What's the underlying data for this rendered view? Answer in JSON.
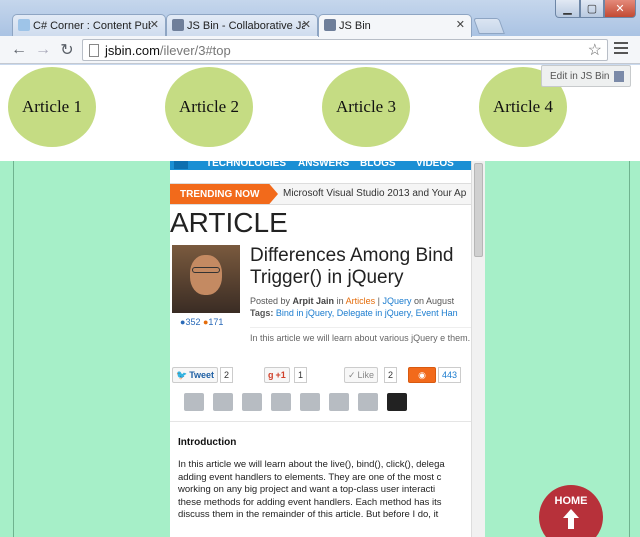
{
  "tabs": [
    {
      "title": "C# Corner : Content Publi",
      "active": false
    },
    {
      "title": "JS Bin - Collaborative Java",
      "active": false
    },
    {
      "title": "JS Bin",
      "active": true
    }
  ],
  "address": {
    "host": "jsbin.com",
    "path": "/ilever/3#top"
  },
  "articles": [
    "Article 1",
    "Article 2",
    "Article 3",
    "Article 4"
  ],
  "edit_button": "Edit in JS Bin",
  "site": {
    "nav": [
      "TECHNOLOGIES",
      "ANSWERS",
      "BLOGS",
      "VIDEOS"
    ],
    "trending_label": "TRENDING NOW",
    "trending_text": "Microsoft Visual Studio 2013 and Your Ap",
    "section_heading": "ARTICLE",
    "title_line1": "Differences Among Bind",
    "title_line2": "Trigger() in jQuery",
    "stats": {
      "a": "352",
      "b": "171"
    },
    "meta": {
      "posted_by": "Posted by",
      "author": "Arpit Jain",
      "in": "in",
      "category": "Articles",
      "sep": "|",
      "subcategory": "JQuery",
      "on": "on August",
      "tags_label": "Tags:",
      "tags": "Bind in jQuery, Delegate in jQuery, Event Han"
    },
    "summary": "In this article we will learn about various jQuery e them.",
    "share": {
      "tweet": "Tweet",
      "tweet_count": "2",
      "gplus": "+1",
      "gplus_count": "1",
      "like": "Like",
      "like_count": "2",
      "views": "443"
    },
    "intro_title": "Introduction",
    "intro_lines": [
      "In this article we will learn about the live(), bind(), click(), delega",
      "adding event handlers to elements. They are one of the most c",
      "working on any big project and want a top-class user interacti",
      "these methods for adding event handlers. Each method has its",
      "discuss them in the remainder of this article. But before I do, it"
    ]
  },
  "home_button": "HOME"
}
